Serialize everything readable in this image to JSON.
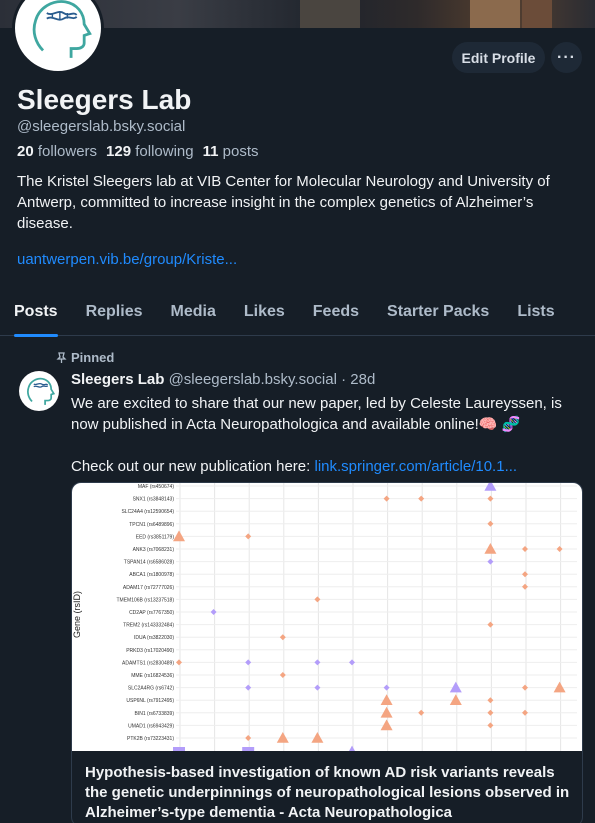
{
  "profile": {
    "name": "Sleegers Lab",
    "handle": "@sleegerslab.bsky.social",
    "followers_count": "20",
    "followers_label": "followers",
    "following_count": "129",
    "following_label": "following",
    "posts_count": "11",
    "posts_label": "posts",
    "bio": "The Kristel Sleegers lab at VIB Center for Molecular Neurology and University of Antwerp, committed to increase insight in the complex genetics of Alzheimer’s disease.",
    "link": "uantwerpen.vib.be/group/Kriste..."
  },
  "actions": {
    "edit_label": "Edit Profile",
    "more_label": "···"
  },
  "tabs": [
    {
      "label": "Posts"
    },
    {
      "label": "Replies"
    },
    {
      "label": "Media"
    },
    {
      "label": "Likes"
    },
    {
      "label": "Feeds"
    },
    {
      "label": "Starter Packs"
    },
    {
      "label": "Lists"
    }
  ],
  "post": {
    "pinned_label": "Pinned",
    "author_name": "Sleegers Lab",
    "author_handle": "@sleegerslab.bsky.social",
    "time": "· 28d",
    "text_line1": "We are excited to share that our new paper, led by Celeste Laureyssen, is now published in Acta Neuropathologica and available online!🧠 🧬",
    "text_line2": "Check out our new publication here: ",
    "text_link": "link.springer.com/article/10.1...",
    "card_title": "Hypothesis-based investigation of known AD risk variants reveals the genetic underpinnings of neuropathological lesions observed in Alzheimer’s-type dementia - Acta Neuropathologica"
  },
  "figure": {
    "ylabel": "Gene (rsID)",
    "genes": [
      "MAF (rs450674)",
      "SNX1 (rs3848143)",
      "SLC24A4 (rs12590654)",
      "TPCN1 (rs6489896)",
      "EED (rs3851179)",
      "ANK3 (rs7068231)",
      "TSPAN14 (rs6586028)",
      "ABCA1 (rs1800978)",
      "ADAM17 (rs72777026)",
      "TMEM106B (rs13237518)",
      "CD2AP (rs7767350)",
      "TREM2 (rs143332484)",
      "IDUA (rs3822030)",
      "PRKD3 (rs17020490)",
      "ADAMTS1 (rs2830489)",
      "MME (rs16824536)",
      "SLC2A4RG (rs6742)",
      "USP6NL (rs7912495)",
      "BIN1 (rs6733839)",
      "UMAD1 (rs6943429)",
      "PTK2B (rs73223431)"
    ]
  },
  "colors": {
    "background": "#161e27",
    "accent": "#208bfe",
    "marker_orange": "#f4a582",
    "marker_purple": "#b39dfa"
  }
}
